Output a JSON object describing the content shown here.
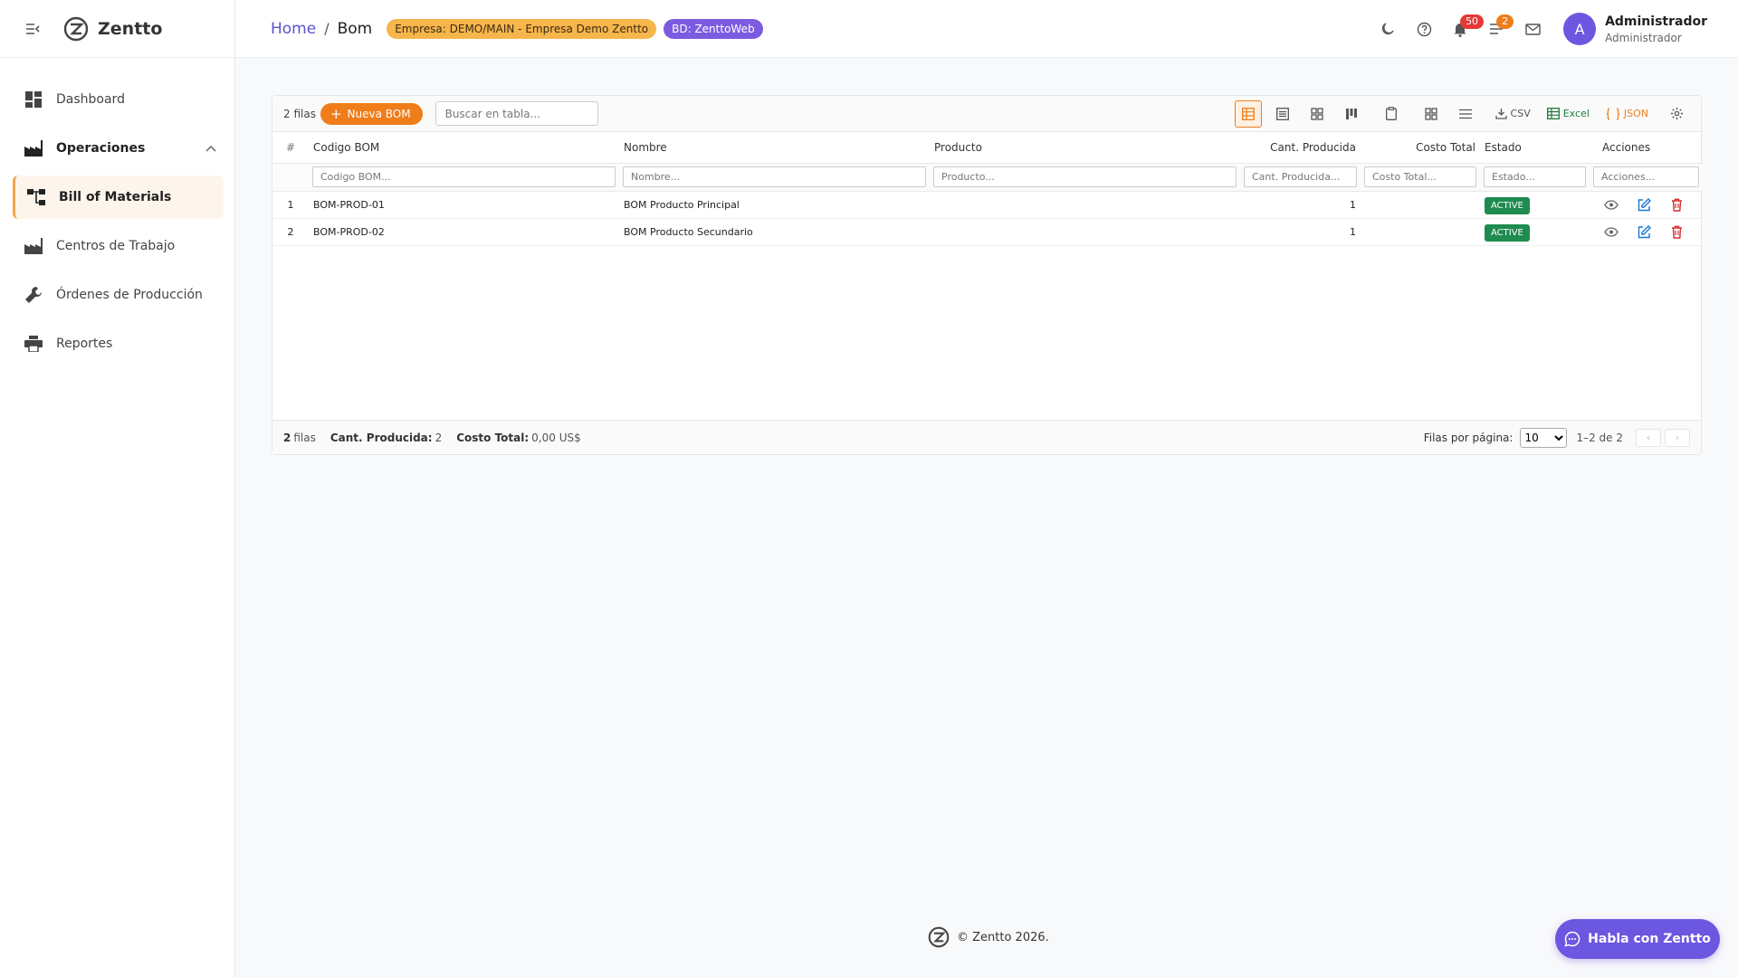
{
  "brand": {
    "name": "Zentto"
  },
  "sidebar": {
    "items": [
      {
        "label": "Dashboard",
        "icon": "dashboard-icon"
      },
      {
        "label": "Operaciones",
        "icon": "factory-icon"
      },
      {
        "label": "Bill of Materials",
        "icon": "tree-icon"
      },
      {
        "label": "Centros de Trabajo",
        "icon": "factory-icon"
      },
      {
        "label": "Órdenes de Producción",
        "icon": "wrench-icon"
      },
      {
        "label": "Reportes",
        "icon": "printer-icon"
      }
    ]
  },
  "header": {
    "home": "Home",
    "separator": "/",
    "current": "Bom",
    "empresa_badge": "Empresa: DEMO/MAIN - Empresa Demo Zentto",
    "bd_badge": "BD: ZenttoWeb",
    "notifications_count": "50",
    "tasks_count": "2",
    "user_initial": "A",
    "user_name": "Administrador",
    "user_role": "Administrador"
  },
  "toolbar": {
    "rows_count": "2 filas",
    "new_label": "Nueva BOM",
    "search_placeholder": "Buscar en tabla...",
    "csv_label": "CSV",
    "excel_label": "Excel",
    "json_label": "JSON"
  },
  "table": {
    "columns": [
      "#",
      "Codigo BOM",
      "Nombre",
      "Producto",
      "Cant. Producida",
      "Costo Total",
      "Estado",
      "Acciones"
    ],
    "filters": [
      "Codigo BOM...",
      "Nombre...",
      "Producto...",
      "Cant. Producida...",
      "Costo Total...",
      "Estado...",
      "Acciones..."
    ],
    "rows": [
      {
        "idx": "1",
        "codigo": "BOM-PROD-01",
        "nombre": "BOM Producto Principal",
        "producto": "",
        "cantidad": "1",
        "costo": "",
        "estado": "ACTIVE"
      },
      {
        "idx": "2",
        "codigo": "BOM-PROD-02",
        "nombre": "BOM Producto Secundario",
        "producto": "",
        "cantidad": "1",
        "costo": "",
        "estado": "ACTIVE"
      }
    ]
  },
  "footer": {
    "rows_num": "2",
    "rows_word": "filas",
    "cant_label": "Cant. Producida:",
    "cant_value": "2",
    "costo_label": "Costo Total:",
    "costo_value": "0,00 US$",
    "per_page_label": "Filas por página:",
    "per_page_value": "10",
    "range": "1–2 de 2"
  },
  "page_footer": {
    "text": "© Zentto 2026."
  },
  "chat": {
    "label": "Habla con Zentto"
  },
  "colors": {
    "accent": "#ef7d1a",
    "brand": "#6b57e0",
    "status_active": "#1e8c4f",
    "delete": "#d32f2f",
    "edit": "#1976d2"
  }
}
